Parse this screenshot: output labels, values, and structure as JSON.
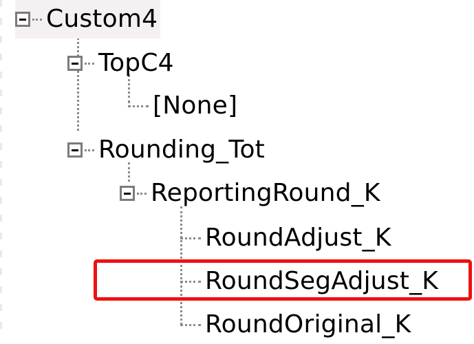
{
  "tree": {
    "root": {
      "label": "Custom4",
      "expanded": true,
      "icon": "minus-box-icon"
    },
    "topc4": {
      "label": "TopC4",
      "expanded": true,
      "icon": "minus-box-icon"
    },
    "none_item": {
      "label": "[None]"
    },
    "rounding_tot": {
      "label": "Rounding_Tot",
      "expanded": true,
      "icon": "minus-box-icon"
    },
    "reporting_round": {
      "label": "ReportingRound_K",
      "expanded": true,
      "icon": "minus-box-icon"
    },
    "round_adjust": {
      "label": "RoundAdjust_K"
    },
    "round_seg_adjust": {
      "label": "RoundSegAdjust_K",
      "highlighted": true
    },
    "round_original": {
      "label": "RoundOriginal_K"
    }
  },
  "colors": {
    "highlight_border": "#ee1111",
    "connector": "#8a8a8a",
    "expander_border": "#7b7b7b",
    "root_background": "#f5f1f2"
  }
}
